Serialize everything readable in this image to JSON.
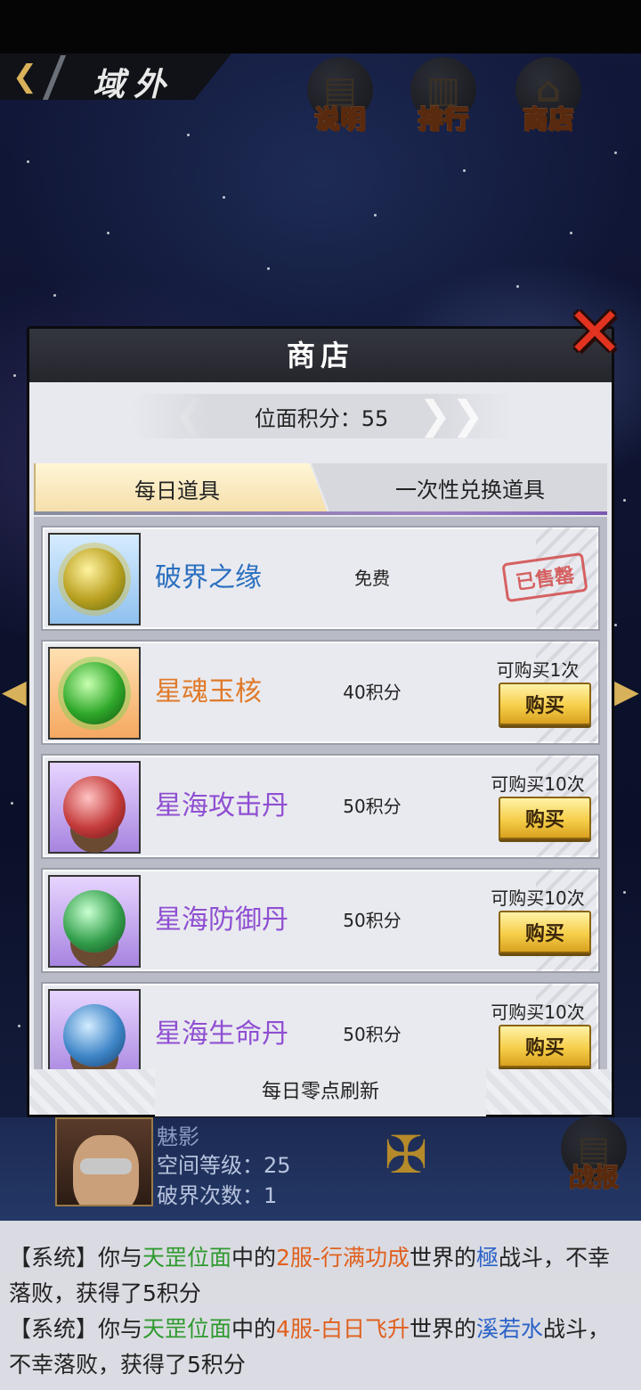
{
  "header": {
    "title": "域外",
    "back_icon": "back-chevron-icon"
  },
  "top_buttons": [
    {
      "label": "说明",
      "icon": "notebook-icon"
    },
    {
      "label": "排行",
      "icon": "banner-icon"
    },
    {
      "label": "商店",
      "icon": "shop-icon"
    }
  ],
  "shop": {
    "title": "商店",
    "score_label": "位面积分：55",
    "tabs": [
      {
        "label": "每日道具",
        "active": true
      },
      {
        "label": "一次性兑换道具",
        "active": false
      }
    ],
    "items": [
      {
        "name": "破界之缘",
        "name_color": "#2a6fc0",
        "price": "免费",
        "limit": "",
        "buy_label": "",
        "sold_label": "已售罄",
        "frame": "blue",
        "orb": "gold-swirl"
      },
      {
        "name": "星魂玉核",
        "name_color": "#e07a2a",
        "price": "40积分",
        "limit": "可购买1次",
        "buy_label": "购买",
        "sold_label": "",
        "frame": "orange",
        "orb": "green"
      },
      {
        "name": "星海攻击丹",
        "name_color": "#8f4fd2",
        "price": "50积分",
        "limit": "可购买10次",
        "buy_label": "购买",
        "sold_label": "",
        "frame": "purple",
        "orb": "red"
      },
      {
        "name": "星海防御丹",
        "name_color": "#8f4fd2",
        "price": "50积分",
        "limit": "可购买10次",
        "buy_label": "购买",
        "sold_label": "",
        "frame": "purple",
        "orb": "green"
      },
      {
        "name": "星海生命丹",
        "name_color": "#8f4fd2",
        "price": "50积分",
        "limit": "可购买10次",
        "buy_label": "购买",
        "sold_label": "",
        "frame": "purple",
        "orb": "blue"
      }
    ],
    "footer": "每日零点刷新"
  },
  "player": {
    "name": "魅影",
    "level": "空间等级：25",
    "breaks": "破界次数：1"
  },
  "report_button": {
    "label": "战报"
  },
  "log": [
    [
      {
        "t": "【系统】你与"
      },
      {
        "t": "天罡位面",
        "c": "g"
      },
      {
        "t": "中的"
      },
      {
        "t": "2服-行满功成",
        "c": "o"
      },
      {
        "t": "世界的"
      },
      {
        "t": "極",
        "c": "b"
      },
      {
        "t": "战斗，不幸落败，获得了5积分"
      }
    ],
    [
      {
        "t": "【系统】你与"
      },
      {
        "t": "天罡位面",
        "c": "g"
      },
      {
        "t": "中的"
      },
      {
        "t": "4服-白日飞升",
        "c": "o"
      },
      {
        "t": "世界的"
      },
      {
        "t": "溪若水",
        "c": "b"
      },
      {
        "t": "战斗，不幸落败，获得了5积分"
      }
    ]
  ]
}
